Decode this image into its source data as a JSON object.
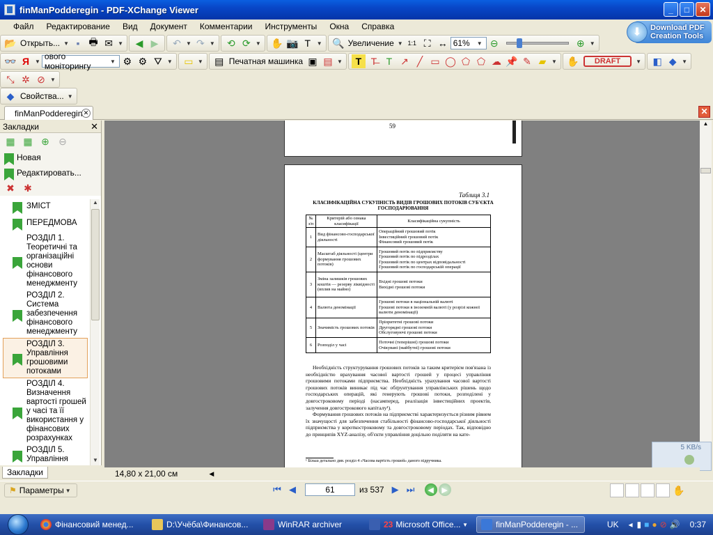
{
  "window": {
    "title": "finManPodderegin - PDF-XChange Viewer"
  },
  "menu": [
    "Файл",
    "Редактирование",
    "Вид",
    "Документ",
    "Комментарии",
    "Инструменты",
    "Окна",
    "Справка"
  ],
  "promo": {
    "line1": "Download PDF",
    "line2": "Creation Tools"
  },
  "toolbar": {
    "open_label": "Открыть...",
    "zoom_label": "Увеличение",
    "zoom_value": "61%",
    "search_text": "ового моніторингу",
    "typewriter_label": "Печатная машинка",
    "draft_stamp": "DRAFT",
    "properties_label": "Свойства..."
  },
  "tab": {
    "label": "finManPodderegin"
  },
  "sidebar": {
    "title": "Закладки",
    "new_label": "Новая",
    "edit_label": "Редактировать...",
    "bottom_tab": "Закладки",
    "bookmarks": [
      {
        "label": "ЗМІСТ"
      },
      {
        "label": "ПЕРЕДМОВА"
      },
      {
        "label": "РОЗДІЛ 1. Теоретичні та організаційні основи фінансового менеджменту"
      },
      {
        "label": "РОЗДІЛ 2. Система забезпечення фінансового менеджменту"
      },
      {
        "label": "РОЗДІЛ 3. Управління грошовими потоками"
      },
      {
        "label": "РОЗДІЛ 4. Визначення вартості грошей у часі та її використання у фінансових розрахунках"
      },
      {
        "label": "РОЗДІЛ 5. Управління"
      }
    ]
  },
  "document": {
    "prev_page_number": "59",
    "table_caption": "Таблиця 3.1",
    "table_title": "КЛАСИФІКАЦІЙНА СУКУПНІСТЬ ВИДІВ ГРОШОВИХ ПОТОКІВ СУБ'ЄКТА ГОСПОДАРЮВАННЯ",
    "table_headers": [
      "№ з/п",
      "Критерій або ознака класифікації",
      "Класифікаційна сукупність"
    ],
    "table_rows": [
      {
        "n": "1",
        "criterion": "Вид фінансово-господарської діяльності",
        "values": "Операційний грошовий потік\nІнвестиційний грошовий потік\nФінансовий грошовий потік"
      },
      {
        "n": "2",
        "criterion": "Масштаб діяльності (центри формування грошових потоків)",
        "values": "Грошовий потік по підприємству\nГрошовий потік по підрозділах\nГрошовий потік по центрах відповідальності\nГрошовий потік по господарській операції"
      },
      {
        "n": "3",
        "criterion": "Зміна залишків грошових коштів — резерву ліквідності (вплив на майно)",
        "values": "Вхідні грошові потоки\nВихідні грошові потоки"
      },
      {
        "n": "4",
        "criterion": "Валюта деномінації",
        "values": "Грошові потоки в національній валюті\nГрошові потоки в іноземній валюті (у розрізі кожної валюти деномінації)"
      },
      {
        "n": "5",
        "criterion": "Значимість грошових потоків",
        "values": "Пріоритетні грошові потоки\nДругорядні грошові потоки\nОбслуговуючі грошові потоки"
      },
      {
        "n": "6",
        "criterion": "Розподіл у часі",
        "values": "Поточні (теперішні) грошові потоки\nОчікувані (майбутні) грошові потоки"
      }
    ],
    "paragraph1": "Необхідність структурування грошових потоків за таким критерієм пов'язана із необхідністю врахування часової вартості грошей у процесі управління грошовими потоками підприємства. Необхідність урахування часової вартості грошових потоків виникає під час обґрунтування управлінських рішень щодо господарських операцій, які генерують грошові потоки, розподілені у довгостроковому періоді (насамперед, реалізація інвестиційних проектів, залучення довгострокового капіталу¹).",
    "paragraph2": "Формування грошових потоків на підприємстві характеризується різним рівнем їх значущості для забезпечення стабільності фінансово-господарської діяльності підприємства у короткостроковому та довгостроковому періодах. Так, відповідно до принципів XYZ-аналізу, об'єкти управління доцільно поділяти на кате-",
    "footnote": "¹ Більш детально див. розділ 4 «Часова вартість грошей» даного підручника."
  },
  "network": {
    "speed": "5 KB/s"
  },
  "sizebar": {
    "page_size": "14,80 x 21,00 см"
  },
  "statusbar": {
    "params_label": "Параметры",
    "current_page": "61",
    "total_pages": "из 537"
  },
  "taskbar": {
    "items": [
      {
        "label": "Фінансовий менед...",
        "color": "#e8a534"
      },
      {
        "label": "D:\\Учёба\\Финансов...",
        "color": "#e8c65a"
      },
      {
        "label": "WinRAR archiver",
        "color": "#8a3a8a"
      },
      {
        "label": "Microsoft Office...",
        "count": "23",
        "color": "#3a5fb0"
      },
      {
        "label": "finManPodderegin - ...",
        "color": "#3b78d8"
      }
    ],
    "lang": "UK",
    "clock": "0:37"
  }
}
